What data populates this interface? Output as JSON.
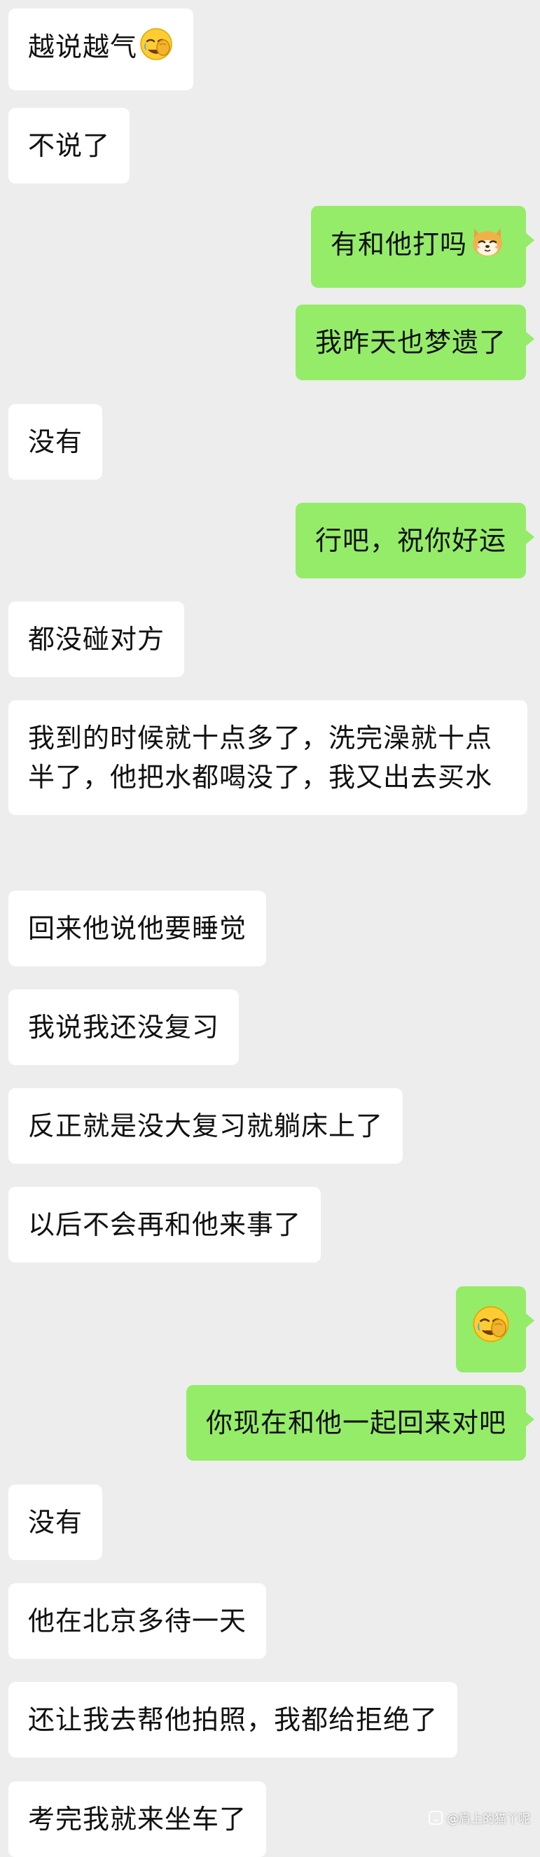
{
  "messages": [
    {
      "side": "left",
      "text": "越说越气",
      "emoji": "facepalm-emoji"
    },
    {
      "side": "left",
      "text": "不说了"
    },
    {
      "side": "right",
      "text": "有和他打吗",
      "emoji": "shiba-emoji"
    },
    {
      "side": "right",
      "text": "我昨天也梦遗了"
    },
    {
      "side": "left",
      "text": "没有"
    },
    {
      "side": "right",
      "text": "行吧，祝你好运"
    },
    {
      "side": "left",
      "text": "都没碰对方"
    },
    {
      "side": "left",
      "text": "我到的时候就十点多了，洗完澡就十点半了，他把水都喝没了，我又出去买水"
    },
    {
      "side": "left",
      "text": "回来他说他要睡觉"
    },
    {
      "side": "left",
      "text": "我说我还没复习"
    },
    {
      "side": "left",
      "text": "反正就是没大复习就躺床上了"
    },
    {
      "side": "left",
      "text": "以后不会再和他来事了"
    },
    {
      "side": "right",
      "text": "",
      "emoji": "facepalm-emoji"
    },
    {
      "side": "right",
      "text": "你现在和他一起回来对吧"
    },
    {
      "side": "left",
      "text": "没有"
    },
    {
      "side": "left",
      "text": "他在北京多待一天"
    },
    {
      "side": "left",
      "text": "还让我去帮他拍照，我都给拒绝了"
    },
    {
      "side": "left",
      "text": "考完我就来坐车了"
    }
  ],
  "watermark": {
    "text": "@肩上的猫丫呢",
    "icon": "chat-bubble-icon"
  },
  "colors": {
    "background": "#ededed",
    "incoming_bubble": "#ffffff",
    "outgoing_bubble": "#95ec69"
  }
}
